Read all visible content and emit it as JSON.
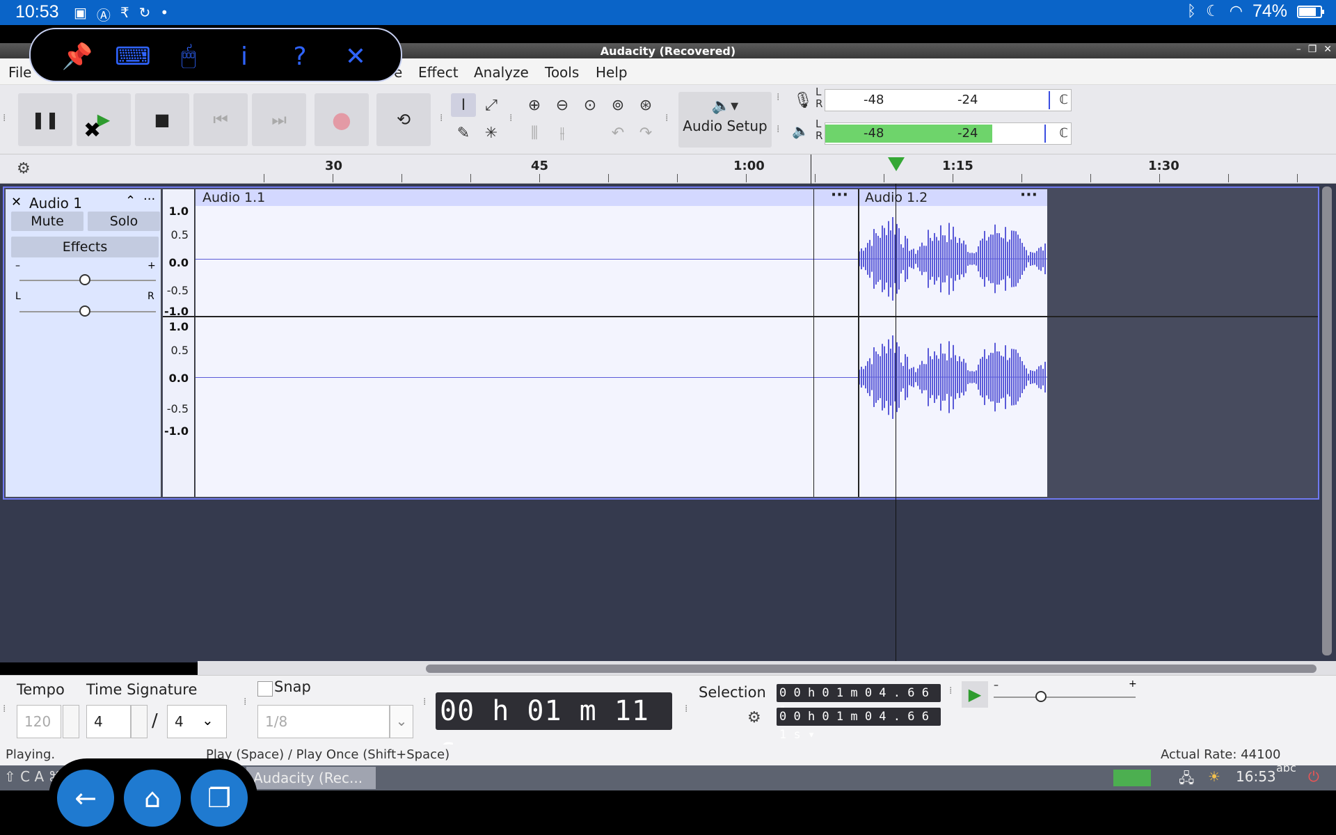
{
  "status_bar": {
    "time": "10:53",
    "battery": "74%"
  },
  "window": {
    "title": "Audacity (Recovered)"
  },
  "menu": [
    "File",
    "e",
    "Effect",
    "Analyze",
    "Tools",
    "Help"
  ],
  "toolbar": {
    "audio_setup": "Audio Setup",
    "meter_record": [
      "-48",
      "-24"
    ],
    "meter_play": [
      "-48",
      "-24"
    ],
    "meter_lr": [
      "L",
      "R"
    ],
    "meter_play_level": 0.68
  },
  "ruler": {
    "ticks": [
      "30",
      "45",
      "1:00",
      "1:15",
      "1:30"
    ]
  },
  "track": {
    "name": "Audio 1",
    "mute": "Mute",
    "solo": "Solo",
    "effects": "Effects",
    "gain_minus": "–",
    "gain_plus": "+",
    "pan_l": "L",
    "pan_r": "R",
    "scale_top": [
      "1.0",
      "0.5",
      "0.0",
      "-0.5",
      "-1.0"
    ],
    "scale_bottom": [
      "1.0",
      "0.5",
      "0.0",
      "-0.5",
      "-1.0"
    ],
    "clips": [
      "Audio 1.1",
      "Audio 1.2"
    ]
  },
  "bottom": {
    "tempo_label": "Tempo",
    "tempo_value": "120",
    "time_sig_label": "Time Signature",
    "time_sig_num": "4",
    "time_sig_slash": "/",
    "time_sig_den": "4",
    "snap_label": "Snap",
    "snap_value": "1/8",
    "time_display": "00 h 01 m 11 s",
    "selection_label": "Selection",
    "selection_start": "0 0 h 0 1 m 0 4 . 6 6 1 s",
    "selection_end": "0 0 h 0 1 m 0 4 . 6 6 1 s"
  },
  "statusline": {
    "left": "Playing.",
    "middle": "Play (Space) / Play Once (Shift+Space)",
    "right": "Actual Rate: 44100"
  },
  "taskbar": {
    "app": "Audacity (Rec...",
    "time": "16:53",
    "kbd": "abc"
  },
  "colors": {
    "accent": "#0a64c8",
    "waveform": "#5a5ad8",
    "meter_green": "#6ed46b"
  }
}
